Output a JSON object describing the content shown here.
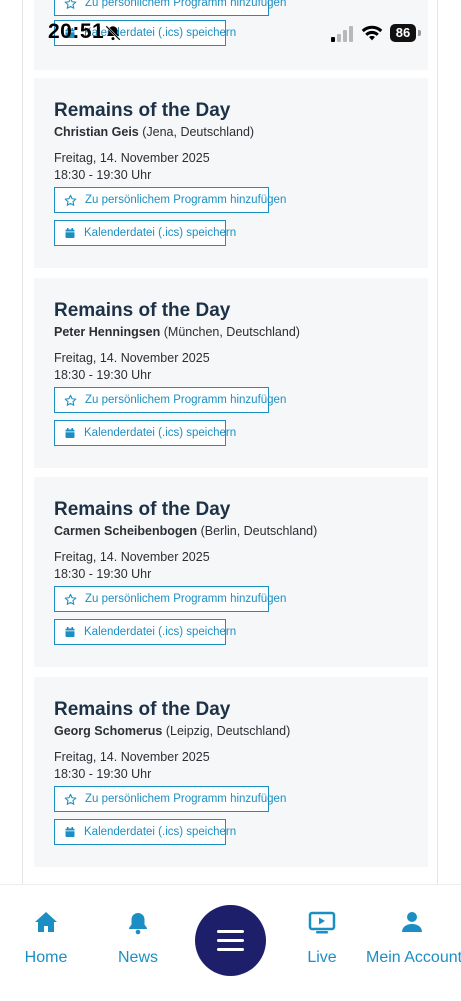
{
  "status_bar": {
    "time": "20:51",
    "battery": "86"
  },
  "cards": [
    {
      "title": "Remains of the Day",
      "name": "Christian Geis",
      "location": "(Jena, Deutschland)",
      "date": "Freitag, 14. November 2025",
      "time": "18:30 - 19:30 Uhr",
      "fav_label": "Zu persönlichem Programm hinzufügen",
      "ics_label": "Kalenderdatei (.ics) speichern"
    },
    {
      "title": "Remains of the Day",
      "name": "Peter Henningsen",
      "location": "(München, Deutschland)",
      "date": "Freitag, 14. November 2025",
      "time": "18:30 - 19:30 Uhr",
      "fav_label": "Zu persönlichem Programm hinzufügen",
      "ics_label": "Kalenderdatei (.ics) speichern"
    },
    {
      "title": "Remains of the Day",
      "name": "Carmen Scheibenbogen",
      "location": "(Berlin, Deutschland)",
      "date": "Freitag, 14. November 2025",
      "time": "18:30 - 19:30 Uhr",
      "fav_label": "Zu persönlichem Programm hinzufügen",
      "ics_label": "Kalenderdatei (.ics) speichern"
    },
    {
      "title": "Remains of the Day",
      "name": "Georg Schomerus",
      "location": "(Leipzig, Deutschland)",
      "date": "Freitag, 14. November 2025",
      "time": "18:30 - 19:30 Uhr",
      "fav_label": "Zu persönlichem Programm hinzufügen",
      "ics_label": "Kalenderdatei (.ics) speichern"
    }
  ],
  "top_partial_card": {
    "fav_label": "Zu persönlichem Programm hinzufügen",
    "ics_label": "Kalenderdatei (.ics) speichern"
  },
  "bottom_nav": {
    "home": "Home",
    "news": "News",
    "live": "Live",
    "account": "Mein Account",
    "menu_icon": "hamburger-menu-icon"
  },
  "colors": {
    "accent": "#1b8fc4",
    "title": "#1d3147",
    "fab": "#1e1f6b",
    "card_bg": "#f6f7f8"
  }
}
